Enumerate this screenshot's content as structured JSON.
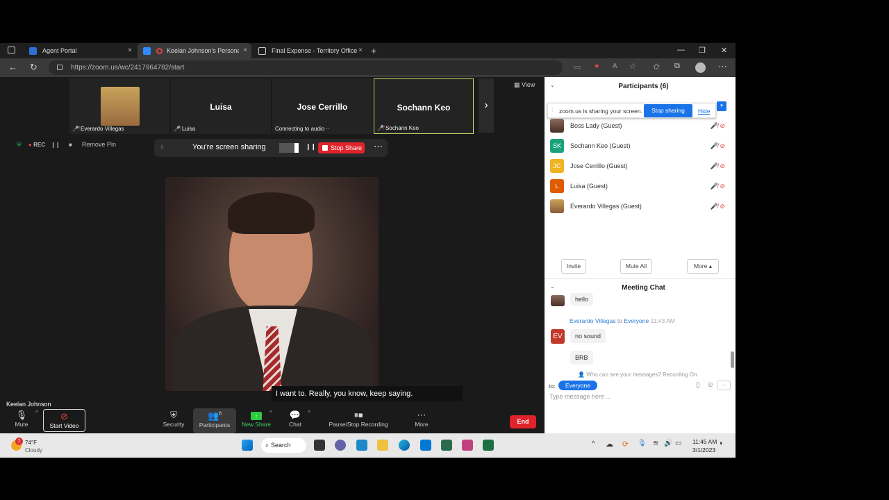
{
  "browser": {
    "tabs": [
      {
        "label": "Agent Portal",
        "close": "×"
      },
      {
        "label": "Keelan Johnson's Personal M",
        "close": "×"
      },
      {
        "label": "Final Expense - Territory Office",
        "close": "×"
      }
    ],
    "new_tab": "+",
    "url": "https://zoom.us/wc/2417964782/start"
  },
  "zoom": {
    "tiles": [
      {
        "name": "",
        "label": "Everardo Villegas"
      },
      {
        "name": "Luisa",
        "label": "Luisa"
      },
      {
        "name": "Jose Cerrillo",
        "label": "Connecting to audio"
      },
      {
        "name": "Sochann Keo",
        "label": "Sochann Keo"
      }
    ],
    "view_label": "View",
    "rec_label": "REC",
    "remove_pin": "Remove Pin",
    "sharing_text": "You're screen sharing",
    "stop_share": "Stop Share",
    "caption": "I want to. Really, you know, keep saying.",
    "self_name": "Keelan Johnson",
    "toolbar": {
      "mute": "Mute",
      "start_video": "Start Video",
      "security": "Security",
      "participants": "Participants",
      "participants_count": "6",
      "new_share": "New Share",
      "chat": "Chat",
      "recording": "Pause/Stop Recording",
      "more": "More",
      "end": "End"
    }
  },
  "panel": {
    "participants_title": "Participants (6)",
    "share_note": "zoom.us is sharing your screen.",
    "stop_sharing": "Stop sharing",
    "hide": "Hide",
    "participants": [
      {
        "initials": "",
        "name": "Boss Lady (Guest)",
        "color": "#6b4a3a"
      },
      {
        "initials": "SK",
        "name": "Sochann Keo (Guest)",
        "color": "#1aa37a"
      },
      {
        "initials": "JC",
        "name": "Jose Cerrillo (Guest)",
        "color": "#f0b323"
      },
      {
        "initials": "L",
        "name": "Luisa (Guest)",
        "color": "#e05a00"
      },
      {
        "initials": "",
        "name": "Everardo Villegas (Guest)",
        "color": "#b08060"
      }
    ],
    "invite": "Invite",
    "mute_all": "Mute All",
    "more": "More",
    "chat_title": "Meeting Chat",
    "chat": [
      {
        "from": "",
        "to": "",
        "time": "",
        "text": "hello"
      },
      {
        "from": "Everardo Villegas",
        "to_word": "to",
        "to": "Everyone",
        "time": "11:43 AM",
        "text": "no sound"
      },
      {
        "from": "",
        "to": "",
        "time": "",
        "text": "BRB"
      }
    ],
    "ev_initials": "EV",
    "who_can_see": "Who can see your messages? Recording On",
    "to_label": "to:",
    "to_target": "Everyone",
    "placeholder": "Type message here ..."
  },
  "taskbar": {
    "temp": "74°F",
    "weather": "Cloudy",
    "search": "Search",
    "time": "11:45 AM",
    "date": "3/1/2023",
    "notif": "1"
  }
}
